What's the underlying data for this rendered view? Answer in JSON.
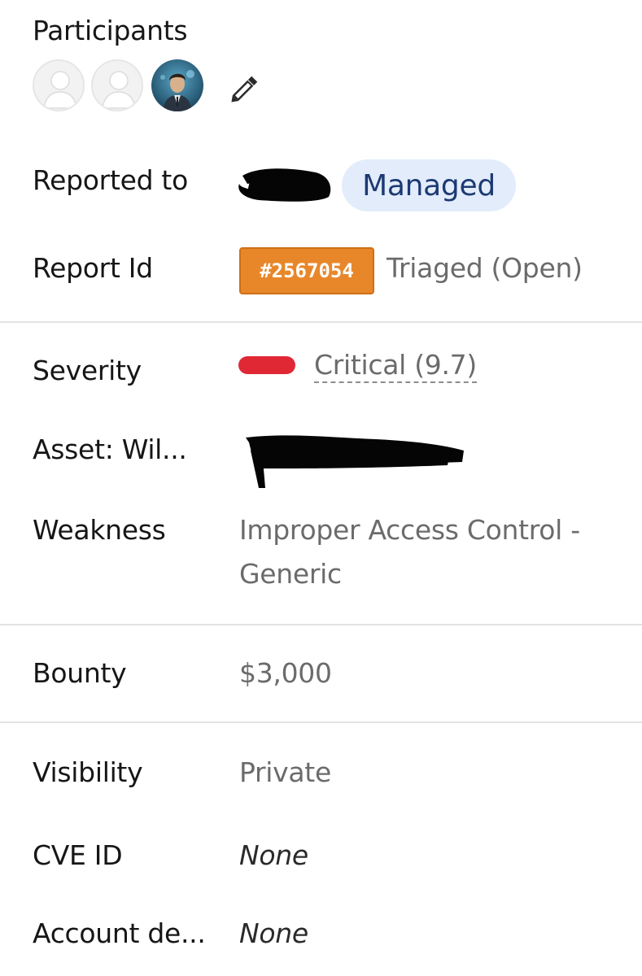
{
  "participants": {
    "label": "Participants",
    "avatars": [
      "blank-avatar",
      "blank-avatar",
      "user-photo-avatar"
    ],
    "edit_icon": "pencil-icon"
  },
  "reported_to": {
    "label": "Reported to",
    "badge": "Managed"
  },
  "report_id": {
    "label": "Report Id",
    "id": "#2567054",
    "status": "Triaged (Open)",
    "badge_color": "#e8872a"
  },
  "severity": {
    "label": "Severity",
    "value": "Critical (9.7)",
    "color": "#e02835"
  },
  "asset": {
    "label": "Asset: Wil..."
  },
  "weakness": {
    "label": "Weakness",
    "value_line1": "Improper Access Control -",
    "value_line2": "Generic"
  },
  "bounty": {
    "label": "Bounty",
    "value": "$3,000"
  },
  "visibility": {
    "label": "Visibility",
    "value": "Private"
  },
  "cve": {
    "label": "CVE ID",
    "value": "None"
  },
  "account": {
    "label": "Account de...",
    "value": "None"
  }
}
